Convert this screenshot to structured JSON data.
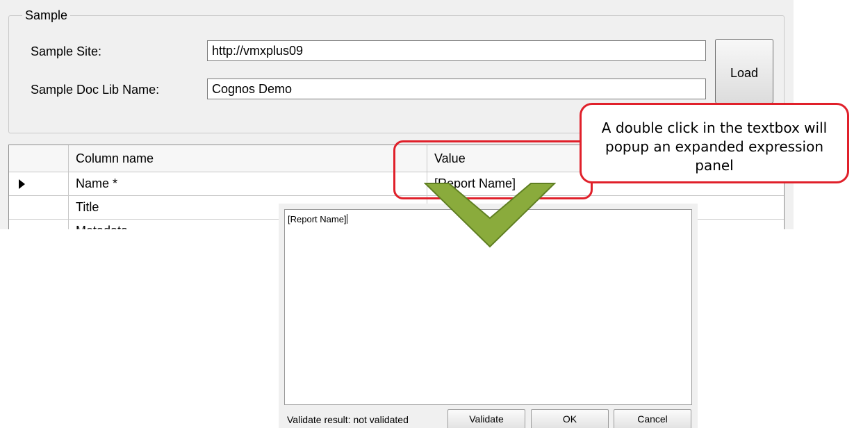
{
  "sample": {
    "group_title": "Sample",
    "site_label": "Sample Site:",
    "site_value": "http://vmxplus09",
    "doclib_label": "Sample Doc Lib Name:",
    "doclib_value": "Cognos Demo",
    "load_label": "Load"
  },
  "grid": {
    "headers": [
      "Column name",
      "Value"
    ],
    "rows": [
      {
        "name": "Name *",
        "value": "[Report Name]",
        "current": true
      },
      {
        "name": "Title",
        "value": ""
      },
      {
        "name": "Metadata",
        "value": ""
      }
    ]
  },
  "callout": {
    "text": "A double click in the textbox will popup an expanded expression panel"
  },
  "popup": {
    "editor_text": "[Report Name]",
    "status_text": "Validate result: not validated",
    "validate_label": "Validate",
    "ok_label": "OK",
    "cancel_label": "Cancel"
  },
  "colors": {
    "annotation_red": "#e0202a",
    "arrow_green": "#8aab3c",
    "arrow_outline": "#5f7f22"
  },
  "icons": {
    "current_row": "row-pointer-icon",
    "arrow": "chevron-down-icon"
  }
}
